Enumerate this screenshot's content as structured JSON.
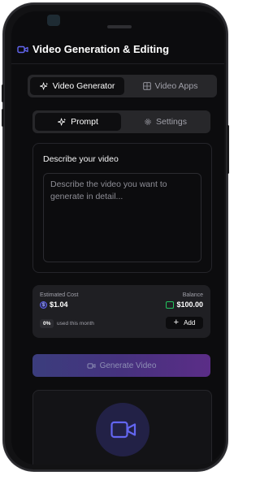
{
  "header": {
    "title": "Video Generation & Editing",
    "icon": "video-camera-icon"
  },
  "mode_switch": {
    "active": "Video Generator",
    "items": [
      {
        "label": "Video Generator",
        "icon": "sparkles-icon"
      },
      {
        "label": "Video Apps",
        "icon": "grid-icon"
      }
    ]
  },
  "sub_tabs": {
    "active": "Prompt",
    "items": [
      {
        "label": "Prompt",
        "icon": "sparkles-icon"
      },
      {
        "label": "Settings",
        "icon": "gear-icon"
      }
    ]
  },
  "prompt": {
    "label": "Describe your video",
    "placeholder": "Describe the video you want to generate in detail...",
    "value": ""
  },
  "cost": {
    "estimated_label": "Estimated Cost",
    "estimated_value": "$1.04",
    "balance_label": "Balance",
    "balance_value": "$100.00",
    "usage_percent": "0%",
    "usage_text": "used this month",
    "add_label": "Add"
  },
  "generate": {
    "label": "Generate Video"
  },
  "colors": {
    "background": "#0c0c0e",
    "accent": "#6366f1",
    "balance_icon": "#22c55e",
    "generate_gradient_start": "#3b3d7d",
    "generate_gradient_end": "#5b2d87"
  }
}
